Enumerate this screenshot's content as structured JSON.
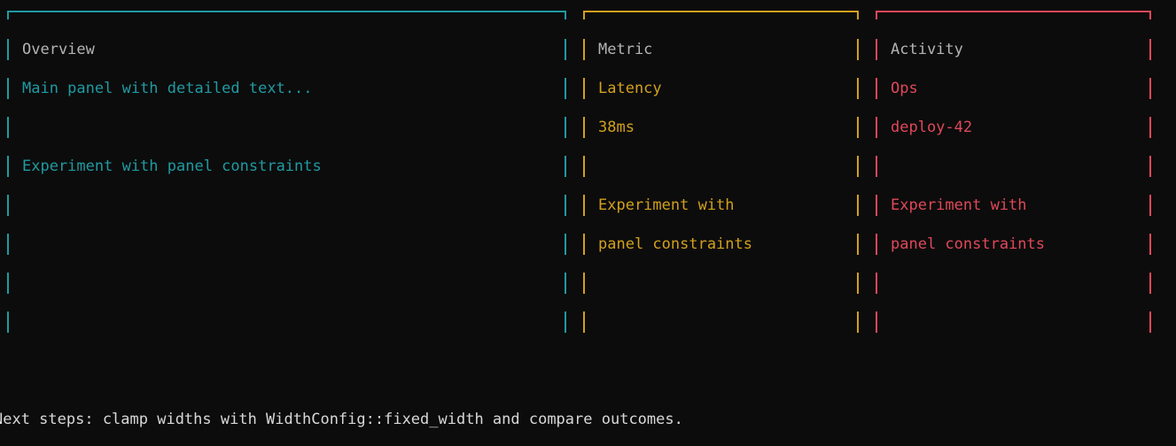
{
  "panels": [
    {
      "title": "Overview",
      "lines": [
        "Main panel with detailed text...",
        "",
        "Experiment with panel constraints",
        "",
        "",
        "",
        ""
      ],
      "color": "#1f9aa2"
    },
    {
      "title": "Metric",
      "lines": [
        "Latency",
        "38ms",
        "",
        "Experiment with",
        "panel constraints",
        "",
        ""
      ],
      "color": "#d2a01e"
    },
    {
      "title": "Activity",
      "lines": [
        "Ops",
        "deploy-42",
        "",
        "Experiment with",
        "panel constraints",
        "",
        ""
      ],
      "color": "#e0485a"
    }
  ],
  "footer": "Next steps: clamp widths with WidthConfig::fixed_width and compare outcomes."
}
